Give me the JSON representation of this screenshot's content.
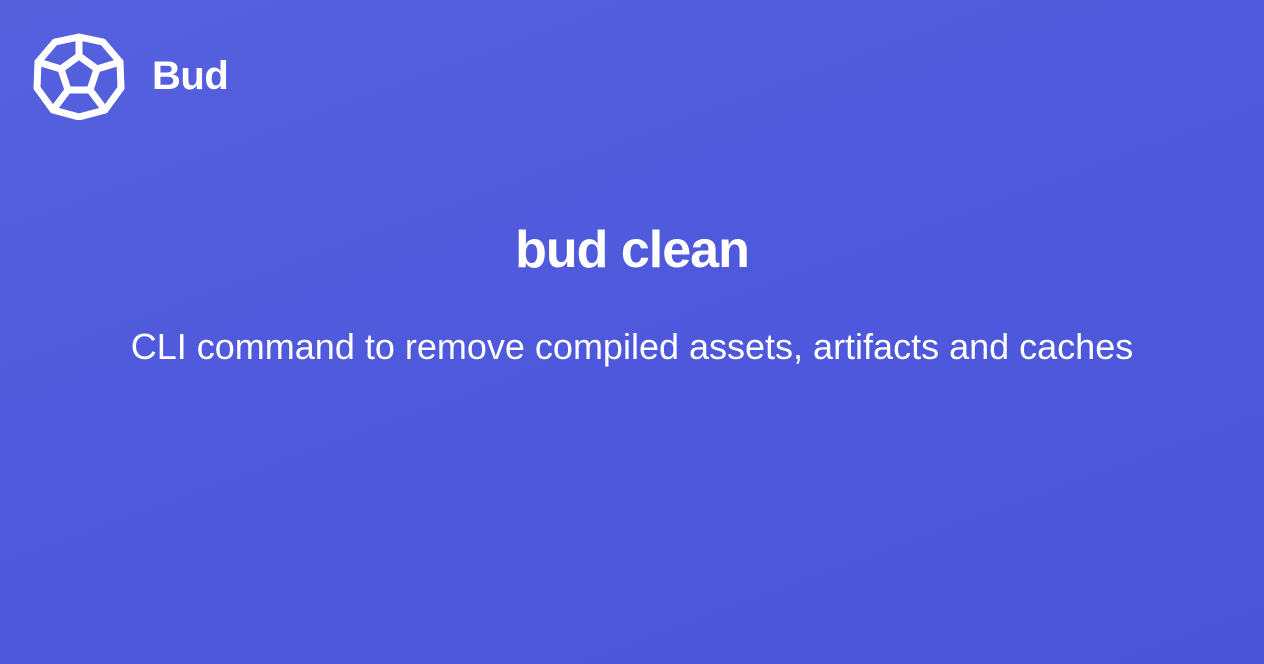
{
  "brand": {
    "name": "Bud",
    "logo_icon": "dodecahedron-icon"
  },
  "hero": {
    "title": "bud clean",
    "subtitle": "CLI command to remove compiled assets, artifacts and caches"
  },
  "colors": {
    "background": "#5059dc",
    "text": "#ffffff"
  }
}
